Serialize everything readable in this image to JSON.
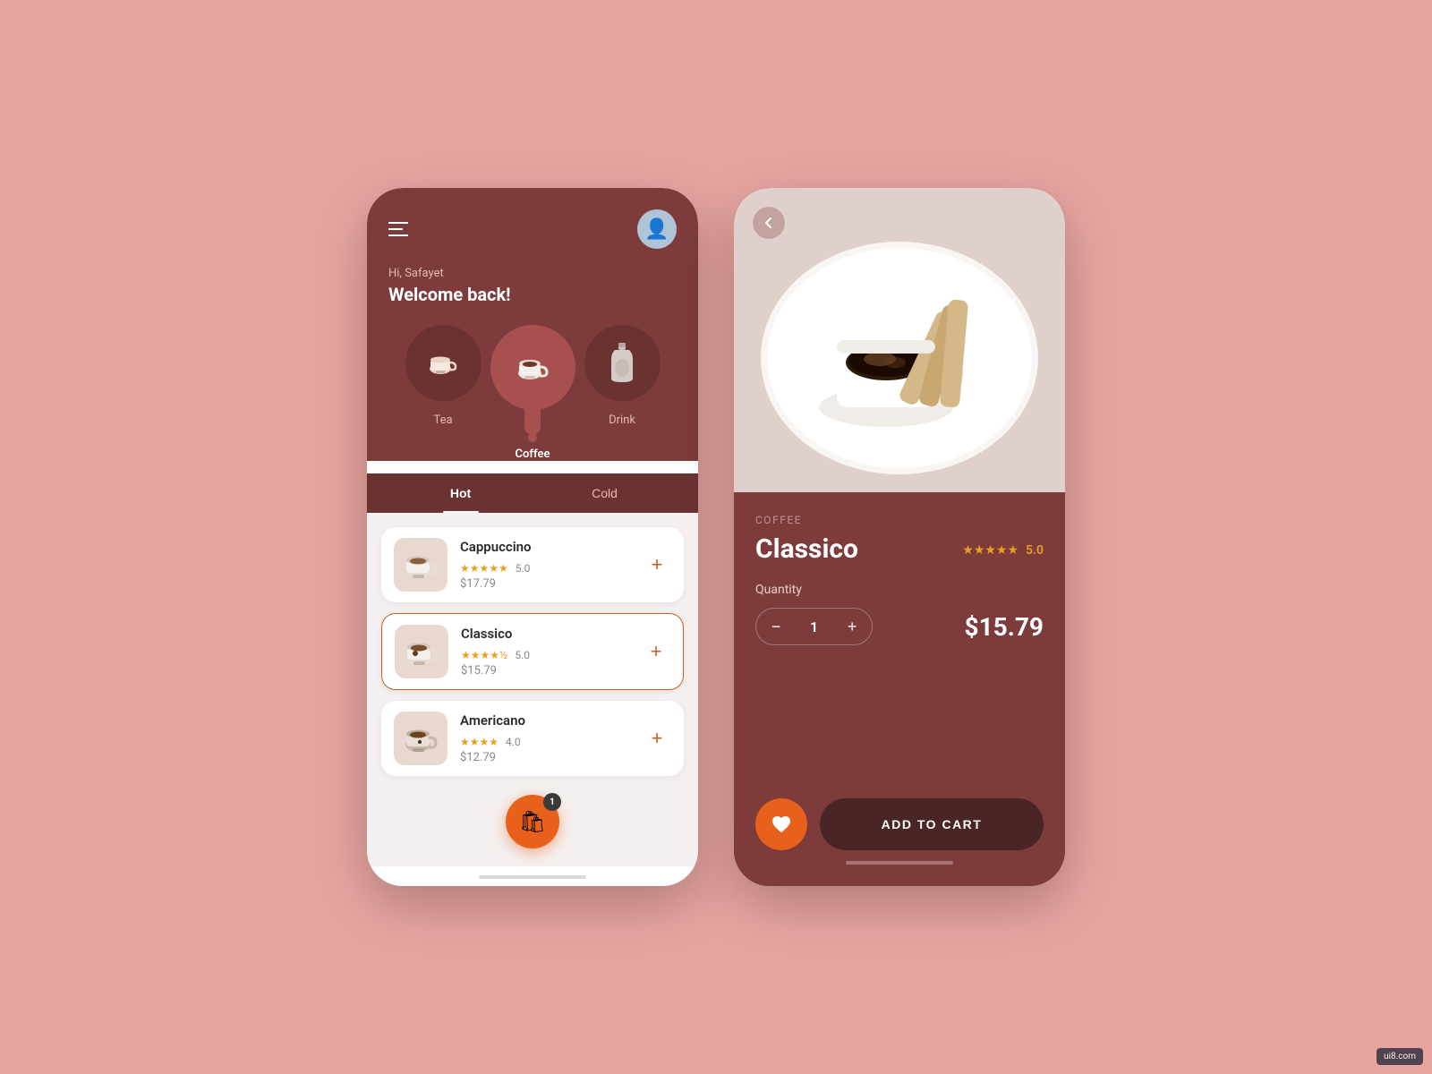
{
  "app": {
    "title": "Coffee Shop App"
  },
  "left_phone": {
    "header": {
      "greeting_sub": "Hi, Safayet",
      "greeting_main": "Welcome back!",
      "hamburger_icon": "☰",
      "avatar_emoji": "👤"
    },
    "categories": [
      {
        "id": "tea",
        "label": "Tea",
        "emoji": "☕",
        "active": false
      },
      {
        "id": "coffee",
        "label": "Coffee",
        "emoji": "☕",
        "active": true
      },
      {
        "id": "drink",
        "label": "Drink",
        "emoji": "🥤",
        "active": false
      }
    ],
    "tabs": [
      {
        "id": "hot",
        "label": "Hot",
        "active": true
      },
      {
        "id": "cold",
        "label": "Cold",
        "active": false
      }
    ],
    "items": [
      {
        "id": "cappuccino",
        "name": "Cappuccino",
        "rating": "5.0",
        "stars": 5,
        "price": "$17.79",
        "selected": false,
        "emoji": "☕"
      },
      {
        "id": "classico",
        "name": "Classico",
        "rating": "5.0",
        "stars": 4.5,
        "price": "$15.79",
        "selected": true,
        "emoji": "☕"
      },
      {
        "id": "americano",
        "name": "Americano",
        "rating": "4.0",
        "stars": 4,
        "price": "$12.79",
        "selected": false,
        "emoji": "☕"
      }
    ],
    "cart": {
      "badge": "1",
      "icon": "🛍"
    }
  },
  "right_phone": {
    "back_icon": "←",
    "category": "COFFEE",
    "name": "Classico",
    "rating": "5.0",
    "stars": 5,
    "quantity_label": "Quantity",
    "quantity": 1,
    "price": "$15.79",
    "add_to_cart": "ADD TO CART",
    "fav_icon": "♥"
  },
  "watermark": "ui8.com"
}
